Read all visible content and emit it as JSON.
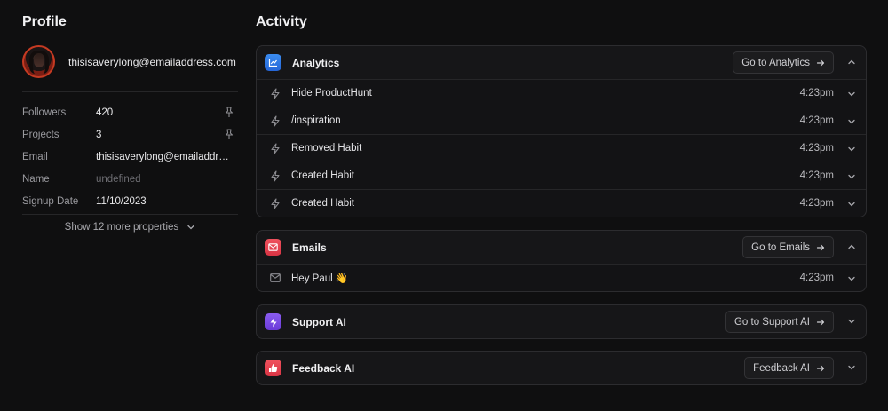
{
  "profile": {
    "title": "Profile",
    "user_email": "thisisaverylong@emailaddress.com",
    "properties": [
      {
        "key": "Followers",
        "value": "420",
        "pinned": true
      },
      {
        "key": "Projects",
        "value": "3",
        "pinned": true
      },
      {
        "key": "Email",
        "value": "thisisaverylong@emailaddress.com",
        "pinned": false
      },
      {
        "key": "Name",
        "value": "undefined",
        "pinned": false
      },
      {
        "key": "Signup Date",
        "value": "11/10/2023",
        "pinned": false
      }
    ],
    "show_more": "Show 12 more properties"
  },
  "activity": {
    "title": "Activity",
    "sections": [
      {
        "name": "Analytics",
        "button": "Go to Analytics",
        "expanded": true,
        "icon": "chart-icon",
        "color": "#2f7de8",
        "rows": [
          {
            "label": "Hide ProductHunt",
            "time": "4:23pm",
            "icon": "bolt-icon"
          },
          {
            "label": "/inspiration",
            "time": "4:23pm",
            "icon": "bolt-icon"
          },
          {
            "label": "Removed Habit",
            "time": "4:23pm",
            "icon": "bolt-icon"
          },
          {
            "label": "Created Habit",
            "time": "4:23pm",
            "icon": "bolt-icon"
          },
          {
            "label": "Created Habit",
            "time": "4:23pm",
            "icon": "bolt-icon"
          }
        ]
      },
      {
        "name": "Emails",
        "button": "Go to Emails",
        "expanded": true,
        "icon": "mail-icon",
        "color": "#e8404f",
        "rows": [
          {
            "label": "Hey Paul 👋",
            "time": "4:23pm",
            "icon": "envelope-icon"
          }
        ]
      },
      {
        "name": "Support AI",
        "button": "Go to Support AI",
        "expanded": false,
        "icon": "bolt-icon",
        "color": "#7b4de6",
        "rows": []
      },
      {
        "name": "Feedback AI",
        "button": "Feedback AI",
        "expanded": false,
        "icon": "thumbs-up-icon",
        "color": "#e8404f",
        "rows": []
      }
    ]
  }
}
